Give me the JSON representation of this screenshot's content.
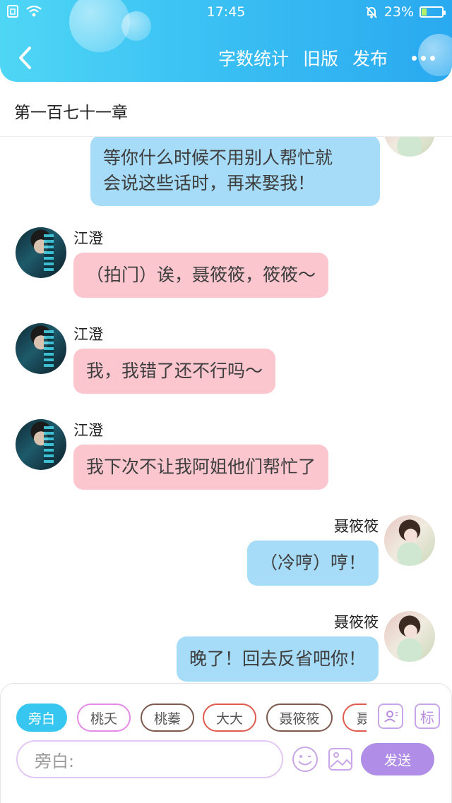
{
  "status_bar": {
    "time": "17:45",
    "battery": "23%"
  },
  "header": {
    "actions": [
      "字数统计",
      "旧版",
      "发布"
    ]
  },
  "chapter": {
    "title": "第一百七十一章"
  },
  "messages": [
    {
      "side": "right",
      "speaker": "",
      "color": "blue",
      "lines": [
        "等你什么时候不用别人帮忙就",
        "会说这些话时，再来娶我！"
      ]
    },
    {
      "side": "left",
      "speaker": "江澄",
      "color": "pink",
      "lines": [
        "（拍门）诶，聂筱筱，筱筱～"
      ]
    },
    {
      "side": "left",
      "speaker": "江澄",
      "color": "pink",
      "lines": [
        "我，我错了还不行吗～"
      ]
    },
    {
      "side": "left",
      "speaker": "江澄",
      "color": "pink",
      "lines": [
        "我下次不让我阿姐他们帮忙了"
      ]
    },
    {
      "side": "right",
      "speaker": "聂筱筱",
      "color": "blue",
      "lines": [
        "（冷哼）哼！"
      ]
    },
    {
      "side": "right",
      "speaker": "聂筱筱",
      "color": "blue",
      "lines": [
        "晚了！回去反省吧你！"
      ]
    }
  ],
  "roles": [
    {
      "label": "旁白",
      "border": "#36c6ef",
      "active": true
    },
    {
      "label": "桃夭",
      "border": "#e58ae6",
      "active": false
    },
    {
      "label": "桃蓁",
      "border": "#7a5a4e",
      "active": false
    },
    {
      "label": "大大",
      "border": "#e05a4e",
      "active": false
    },
    {
      "label": "聂筱筱",
      "border": "#7a5a4e",
      "active": false
    },
    {
      "label": "聂",
      "border": "#e05a4e",
      "active": false
    }
  ],
  "tools": {
    "tag_label": "标"
  },
  "input": {
    "placeholder": "旁白:"
  },
  "send_label": "发送",
  "colors": {
    "header_start": "#4fd6f5",
    "header_end": "#2aa9f0",
    "pink_bubble": "#fcc6cf",
    "blue_bubble": "#a6dcf8",
    "send": "#b08ee8"
  }
}
